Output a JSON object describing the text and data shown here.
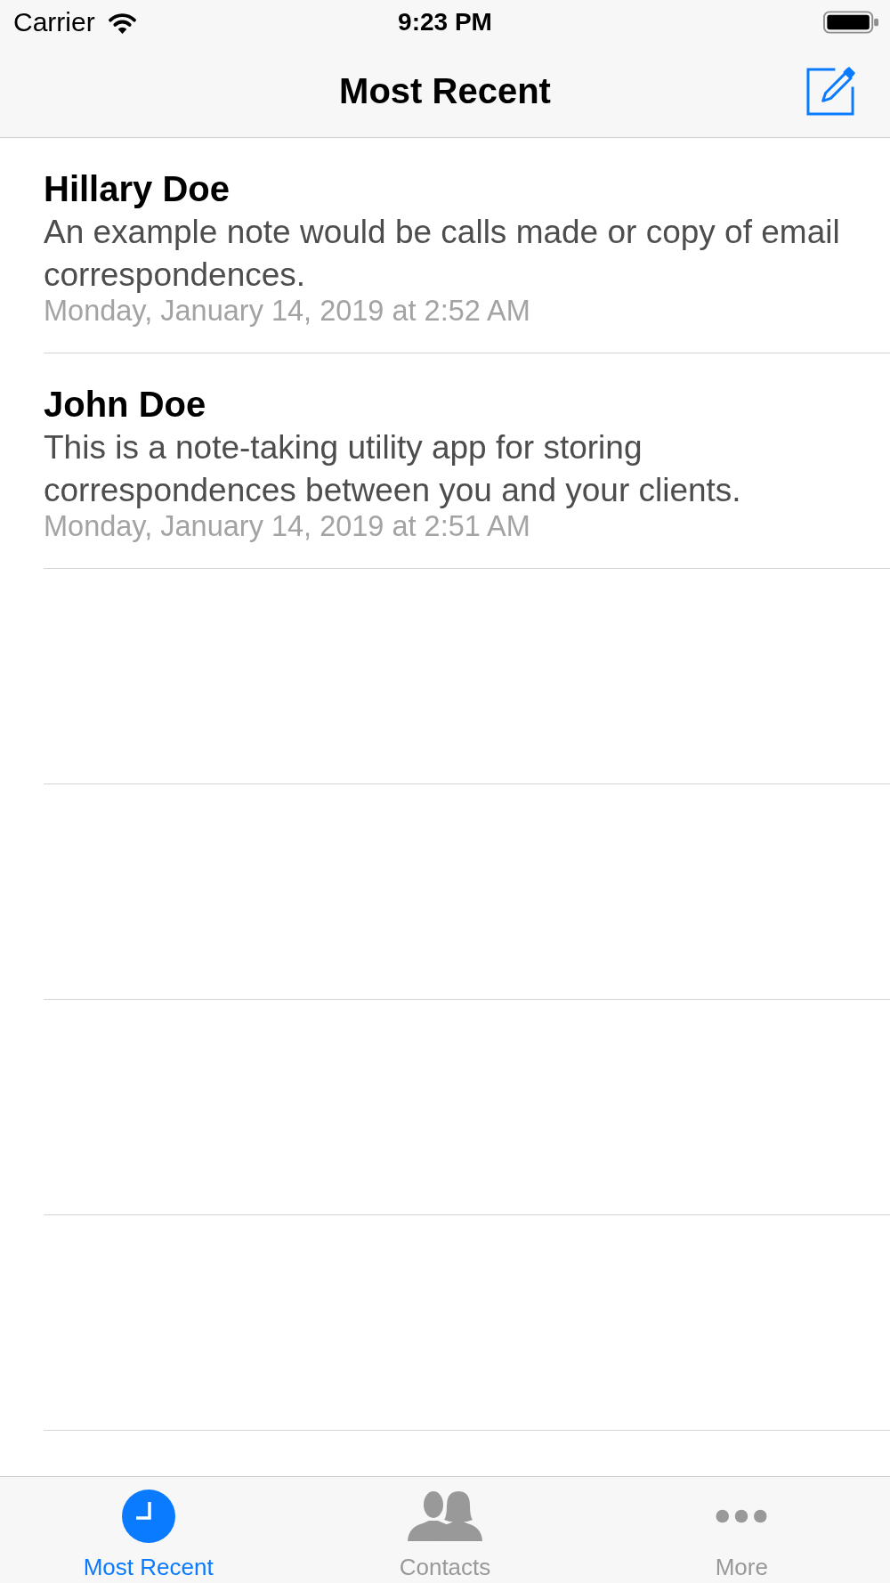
{
  "status_bar": {
    "carrier": "Carrier",
    "time": "9:23 PM"
  },
  "nav_bar": {
    "title": "Most Recent"
  },
  "notes": [
    {
      "name": "Hillary Doe",
      "text": "An example note would be calls made or copy of email correspondences.",
      "date": "Monday, January 14, 2019 at 2:52 AM"
    },
    {
      "name": "John Doe",
      "text": "This is a note-taking utility app for storing correspondences between you and your clients.",
      "date": "Monday, January 14, 2019 at 2:51 AM"
    }
  ],
  "tabs": [
    {
      "label": "Most Recent",
      "selected": true
    },
    {
      "label": "Contacts",
      "selected": false
    },
    {
      "label": "More",
      "selected": false
    }
  ]
}
